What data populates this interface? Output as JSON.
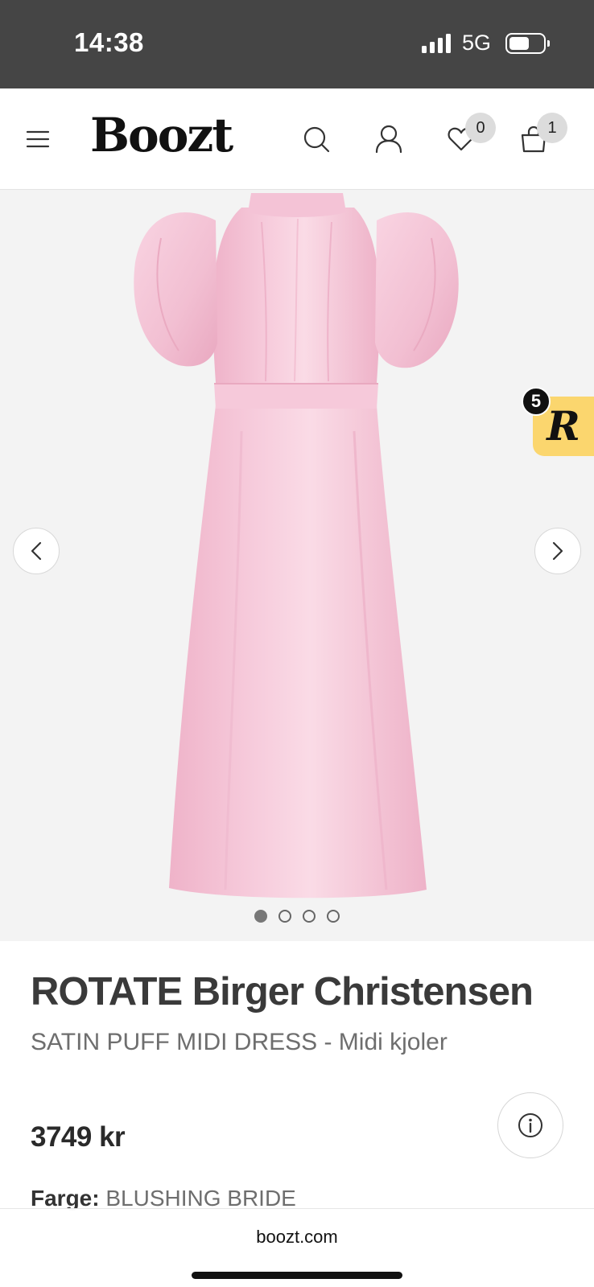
{
  "status_bar": {
    "time": "14:38",
    "network": "5G"
  },
  "header": {
    "logo": "Boozt",
    "wishlist_count": "0",
    "cart_count": "1"
  },
  "gallery": {
    "image_label": "Pink satin puff-sleeve midi dress",
    "dot_count": 4,
    "active_dot": 1
  },
  "widget": {
    "letter": "R",
    "count": "5",
    "color": "#fbd66e"
  },
  "product": {
    "brand": "ROTATE Birger Christensen",
    "name": "SATIN PUFF MIDI DRESS - Midi kjoler",
    "price": "3749 kr",
    "color_label": "Farge:",
    "color_value": "BLUSHING BRIDE"
  },
  "browser": {
    "url": "boozt.com"
  }
}
